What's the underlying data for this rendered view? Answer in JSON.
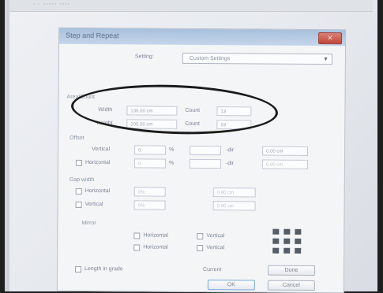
{
  "dialog": {
    "title": "Step and Repeat",
    "close_glyph": "✕",
    "setting_label": "Setting:",
    "setting_value": "Custom Settings",
    "artwork_section": "Area/Count",
    "width_label": "Width",
    "width_value": "136.00 cm",
    "count_label": "Count",
    "count_value": "13",
    "height_label": "Height",
    "height_value": "205.00 cm",
    "count2_label": "Count",
    "count2_value": "19",
    "offset_section": "Offset",
    "vertical_label": "Vertical",
    "v_offset_value": "0",
    "percent_sign": "%",
    "v_dir": "-dir",
    "v_result": "0.00 cm",
    "horizontal_label": "Horizontal",
    "h_offset_value": "0",
    "h_dir": "-dir",
    "h_result": "0.00 cm",
    "gap_section": "Gap width",
    "gap_h_label": "Horizontal",
    "gap_h_value": "0%",
    "gap_h_result": "0.00 cm",
    "gap_v_label": "Vertical",
    "gap_v_value": "0%",
    "gap_v_result": "0.00 cm",
    "mirror_section": "Mirror",
    "mirror_h1": "Horizontal",
    "mirror_v1": "Vertical",
    "mirror_h2": "Horizontal",
    "mirror_v2": "Vertical",
    "length_label": "Length in grade",
    "current_label": "Current",
    "done_button": "Done",
    "ok_button": "OK",
    "cancel_button": "Cancel"
  },
  "colors": {
    "annotation": "#1b1b1b",
    "titlebar": "#b6cbe3",
    "close": "#c9564a"
  }
}
